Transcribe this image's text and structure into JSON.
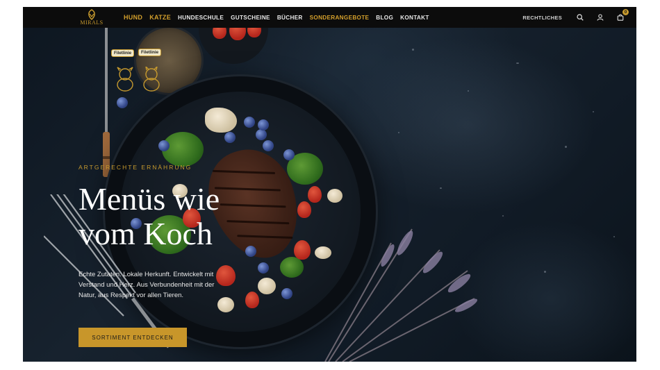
{
  "brand": {
    "logo_text": "MIRALS"
  },
  "nav": {
    "items": [
      {
        "label": "HUND",
        "style": "gold"
      },
      {
        "label": "KATZE",
        "style": "gold"
      },
      {
        "label": "HUNDESCHULE",
        "style": "normal"
      },
      {
        "label": "GUTSCHEINE",
        "style": "normal"
      },
      {
        "label": "BÜCHER",
        "style": "normal"
      },
      {
        "label": "SONDERANGEBOTE",
        "style": "gold"
      },
      {
        "label": "BLOG",
        "style": "normal"
      },
      {
        "label": "KONTAKT",
        "style": "normal"
      }
    ],
    "legal": "RECHTLICHES",
    "icons": [
      "search-icon",
      "user-icon",
      "cart-icon"
    ],
    "cart_count": "0"
  },
  "hero": {
    "kicker": "ARTGERECHTE ERNÄHRUNG",
    "headline_line1": "Menüs wie",
    "headline_line2": "vom Koch",
    "description": "Echte Zutaten. Lokale Herkunft. Entwickelt mit Verstand und Herz. Aus Verbundenheit mit der Natur, aus Respekt vor allen Tieren.",
    "cta_label": "SORTIMENT ENTDECKEN",
    "tags": [
      "Filetlinie",
      "Filetlinie"
    ]
  },
  "colors": {
    "accent": "#c8962a",
    "nav_bg": "#0c0c0c",
    "hero_bg": "#101924"
  }
}
